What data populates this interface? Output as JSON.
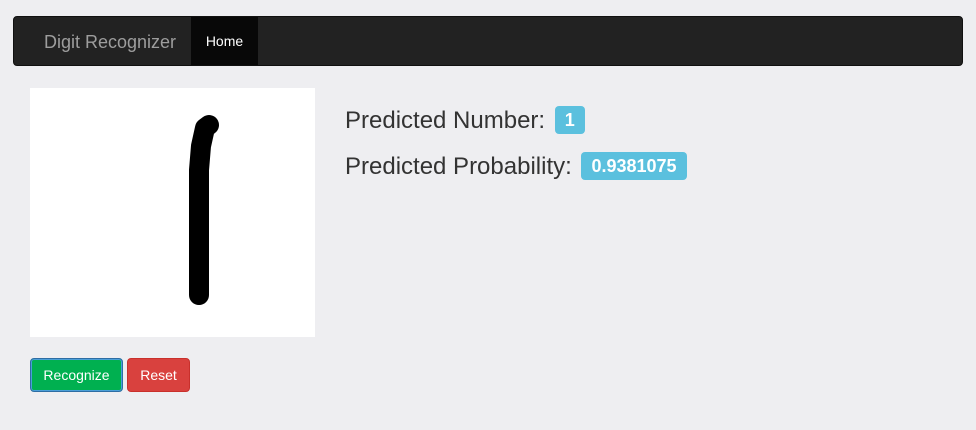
{
  "navbar": {
    "brand": "Digit Recognizer",
    "items": [
      {
        "label": "Home",
        "active": true
      }
    ]
  },
  "prediction": {
    "number_label": "Predicted Number:",
    "number_value": "1",
    "probability_label": "Predicted Probability:",
    "probability_value": "0.9381075"
  },
  "buttons": {
    "recognize_label": "Recognize",
    "reset_label": "Reset"
  },
  "colors": {
    "navbar_bg": "#222222",
    "badge_bg": "#5bc0de",
    "recognize_bg": "#00b050",
    "reset_bg": "#d9413e",
    "page_bg": "#eeeef1"
  }
}
